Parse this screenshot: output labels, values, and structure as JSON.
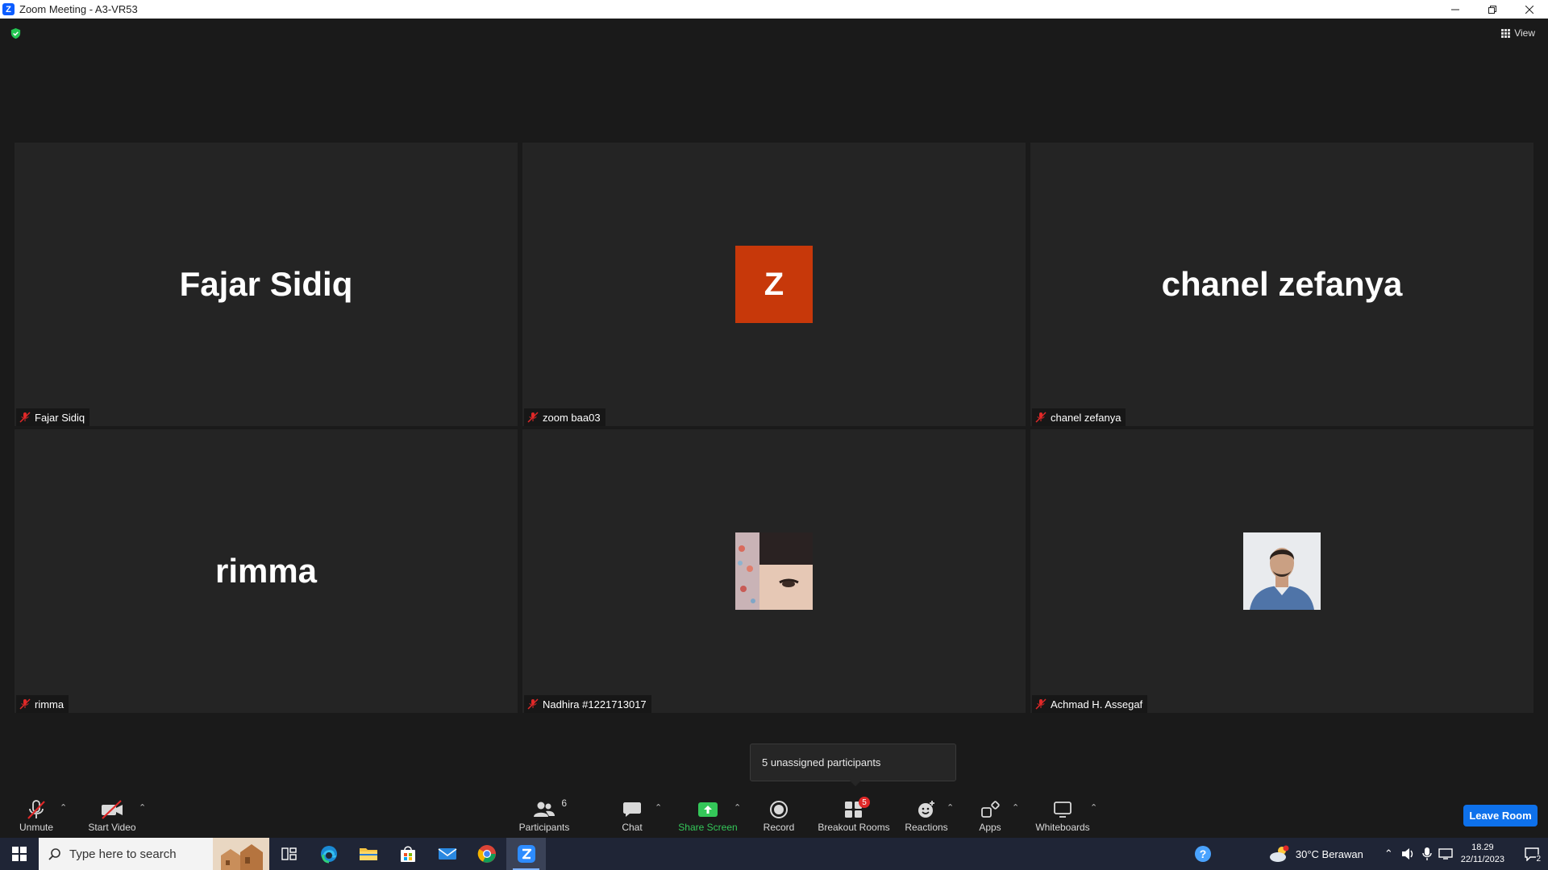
{
  "window": {
    "title": "Zoom Meeting - A3-VR53"
  },
  "view": {
    "label": "View"
  },
  "participants": [
    {
      "display": "Fajar Sidiq",
      "name": "Fajar Sidiq"
    },
    {
      "display": "Z",
      "name": "zoom baa03"
    },
    {
      "display": "chanel zefanya",
      "name": "chanel zefanya"
    },
    {
      "display": "rimma",
      "name": "rimma"
    },
    {
      "display": "",
      "name": "Nadhira #1221713017"
    },
    {
      "display": "",
      "name": "Achmad H. Assegaf"
    }
  ],
  "tooltip": {
    "text": "5 unassigned participants"
  },
  "toolbar": {
    "unmute": "Unmute",
    "start_video": "Start Video",
    "participants": "Participants",
    "participants_count": "6",
    "chat": "Chat",
    "share_screen": "Share Screen",
    "record": "Record",
    "breakout_rooms": "Breakout Rooms",
    "breakout_count": "5",
    "reactions": "Reactions",
    "apps": "Apps",
    "whiteboards": "Whiteboards",
    "leave": "Leave Room"
  },
  "taskbar": {
    "search_placeholder": "Type here to search",
    "weather": "30°C  Berawan",
    "time": "18.29",
    "date": "22/11/2023",
    "notification_count": "2"
  },
  "colors": {
    "accent": "#0e71eb",
    "share_green": "#34c759",
    "avatar_orange": "#c7380a",
    "mute_red": "#e02828"
  }
}
